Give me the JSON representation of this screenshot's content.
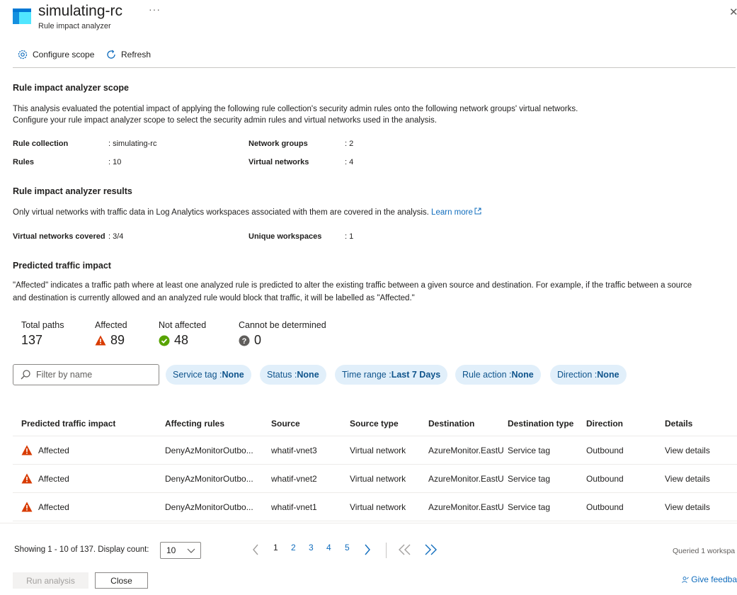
{
  "header": {
    "title": "simulating-rc",
    "subtitle": "Rule impact analyzer",
    "more_label": "···",
    "close_label": "✕"
  },
  "toolbar": {
    "configure_label": "Configure scope",
    "refresh_label": "Refresh"
  },
  "scope": {
    "title": "Rule impact analyzer scope",
    "line1": "This analysis evaluated the potential impact of applying the following rule collection's security admin rules onto the following network groups' virtual networks.",
    "line2": "Configure your rule impact analyzer scope to select the security admin rules and virtual networks used in the analysis.",
    "rule_collection_label": "Rule collection",
    "rule_collection_value": ": simulating-rc",
    "rules_label": "Rules",
    "rules_value": ": 10",
    "network_groups_label": "Network groups",
    "network_groups_value": ": 2",
    "virtual_networks_label": "Virtual networks",
    "virtual_networks_value": ": 4"
  },
  "results": {
    "title": "Rule impact analyzer results",
    "description": "Only virtual networks with traffic data in Log Analytics workspaces associated with them are covered in the analysis.",
    "learn_more": "Learn more",
    "vnets_covered_label": "Virtual networks covered",
    "vnets_covered_value": ": 3/4",
    "unique_workspaces_label": "Unique workspaces",
    "unique_workspaces_value": ": 1"
  },
  "impact": {
    "title": "Predicted traffic impact",
    "line1": "\"Affected\" indicates a traffic path where at least one analyzed rule is predicted to alter the existing traffic between a given source and destination. For example, if the traffic between a source",
    "line2": "and destination is currently allowed and an analyzed rule would block that traffic, it will be labelled as \"Affected.\""
  },
  "stats": {
    "total_label": "Total paths",
    "total_value": "137",
    "affected_label": "Affected",
    "affected_value": "89",
    "not_affected_label": "Not affected",
    "not_affected_value": "48",
    "undetermined_label": "Cannot be determined",
    "undetermined_value": "0"
  },
  "filters": {
    "search_placeholder": "Filter by name",
    "service_tag_label": "Service tag : ",
    "service_tag_value": "None",
    "status_label": "Status : ",
    "status_value": "None",
    "time_range_label": "Time range : ",
    "time_range_value": "Last 7 Days",
    "rule_action_label": "Rule action : ",
    "rule_action_value": "None",
    "direction_label": "Direction : ",
    "direction_value": "None"
  },
  "table": {
    "headers": [
      "Predicted traffic impact",
      "Affecting rules",
      "Source",
      "Source type",
      "Destination",
      "Destination type",
      "Direction",
      "Details"
    ],
    "rows": [
      [
        "Affected",
        "DenyAzMonitorOutbo...",
        "whatif-vnet3",
        "Virtual network",
        "AzureMonitor.EastU",
        "Service tag",
        "Outbound",
        "View details"
      ],
      [
        "Affected",
        "DenyAzMonitorOutbo...",
        "whatif-vnet2",
        "Virtual network",
        "AzureMonitor.EastU",
        "Service tag",
        "Outbound",
        "View details"
      ],
      [
        "Affected",
        "DenyAzMonitorOutbo...",
        "whatif-vnet1",
        "Virtual network",
        "AzureMonitor.EastU",
        "Service tag",
        "Outbound",
        "View details"
      ]
    ]
  },
  "pagination": {
    "showing": "Showing 1 - 10 of 137. Display count:",
    "display_count": "10",
    "pages": [
      "1",
      "2",
      "3",
      "4",
      "5"
    ],
    "current_page": "1",
    "queried": "Queried 1 workspa"
  },
  "footer": {
    "run_label": "Run analysis",
    "close_label": "Close",
    "feedback_label": "Give feedba"
  },
  "colors": {
    "accent": "#0f6cbd",
    "warning": "#d83b01",
    "success": "#57a300",
    "neutral": "#605e5c",
    "pill_bg": "#e1effa"
  }
}
